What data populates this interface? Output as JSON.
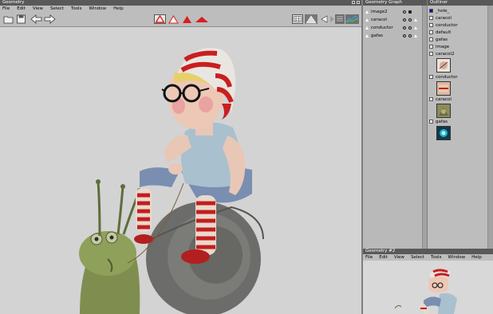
{
  "main_window": {
    "title": "Geometry",
    "menu": [
      "File",
      "Edit",
      "View",
      "Select",
      "Tools",
      "Window",
      "Help"
    ]
  },
  "graph_window": {
    "title": "Geometry Graph",
    "items": [
      "image2",
      "caracol",
      "conductor",
      "gafas"
    ]
  },
  "outliner_window": {
    "title": "Outliner",
    "items": [
      "_hole_",
      "caracol",
      "conductor",
      "default",
      "gafas",
      "image",
      "caracol2",
      "conductor",
      "caracol",
      "gafas"
    ]
  },
  "second_window": {
    "title": "Geometry #2",
    "menu": [
      "File",
      "Edit",
      "View",
      "Select",
      "Tools",
      "Window",
      "Help"
    ]
  },
  "colors": {
    "accent_red": "#d81e1e",
    "titlebar": "#595959",
    "viewport_bg": "#d3d3d3",
    "outliner_swatch_hole": "#101090",
    "outliner_swatch_gafas": "#1fb0c8"
  },
  "icons": [
    "open-folder-icon",
    "save-icon",
    "back-arrow-icon",
    "forward-arrow-icon",
    "shading-red-outline-icon",
    "shading-white-icon",
    "shading-red-filled-icon",
    "shading-red-flat-icon",
    "grid-view-icon",
    "solid-view-icon",
    "prev-icon",
    "next-icon",
    "list-view-icon",
    "graph-view-icon"
  ]
}
